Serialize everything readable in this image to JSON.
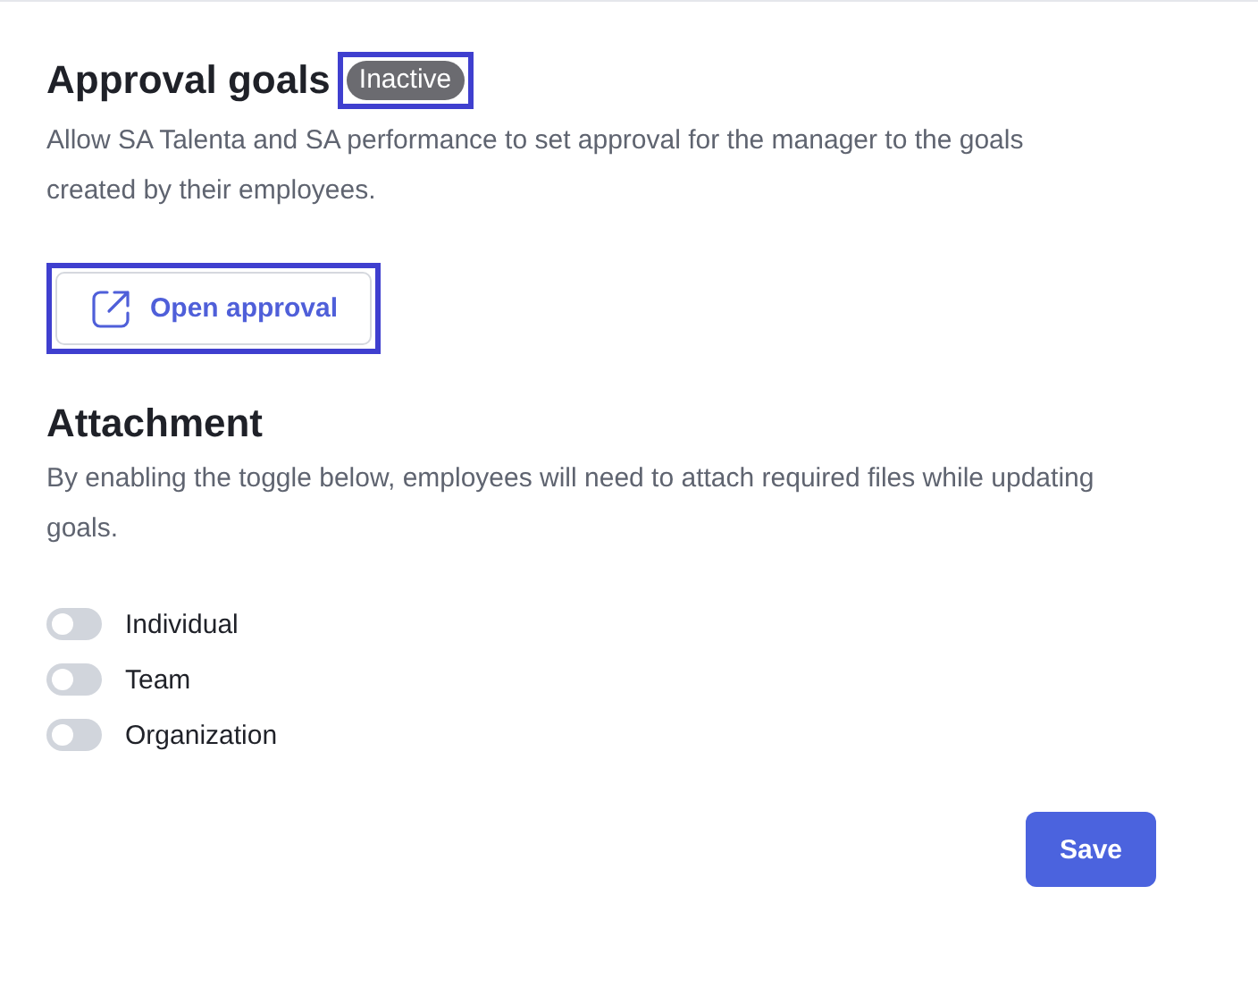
{
  "approval": {
    "title": "Approval goals",
    "status": "Inactive",
    "active": false,
    "highlighted": true,
    "description": "Allow SA Talenta and SA performance to set approval for the manager to the goals created by their employees.",
    "button": "Open approval"
  },
  "attachment": {
    "title": "Attachment",
    "description": "By enabling the toggle below, employees will need to attach required files while updating goals.",
    "toggles": [
      {
        "label": "Individual",
        "on": false
      },
      {
        "label": "Team",
        "on": false
      },
      {
        "label": "Organization",
        "on": false
      }
    ]
  },
  "save_button": "Save"
}
